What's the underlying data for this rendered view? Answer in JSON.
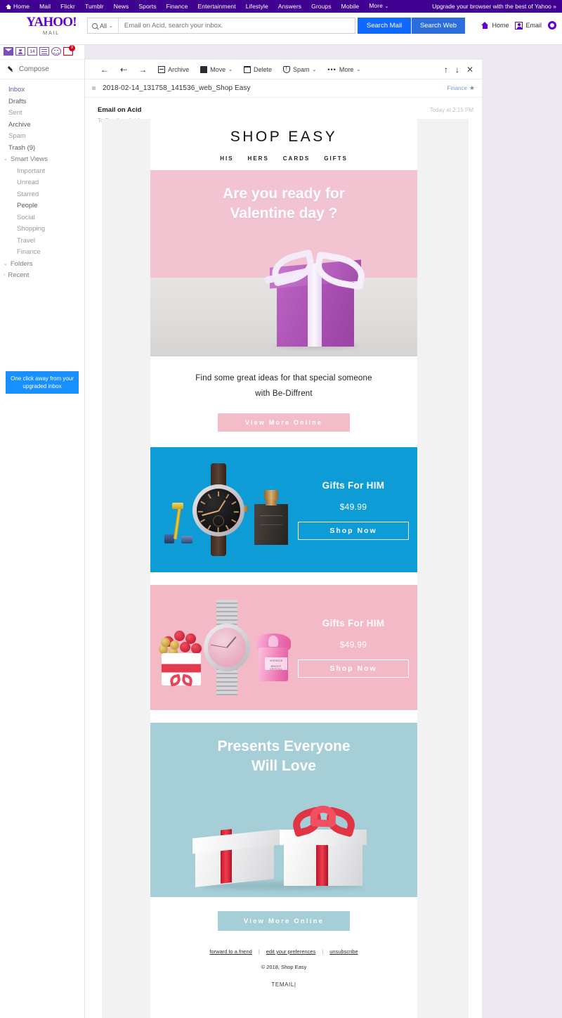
{
  "topnav": {
    "items": [
      "Home",
      "Mail",
      "Flickr",
      "Tumblr",
      "News",
      "Sports",
      "Finance",
      "Entertainment",
      "Lifestyle",
      "Answers",
      "Groups",
      "Mobile",
      "More"
    ],
    "more_caret": "⌄",
    "upgrade_text": "Upgrade your browser with the best of Yahoo »",
    "bg_color": "#400090"
  },
  "header": {
    "logo_main": "YAHOO!",
    "logo_sub": "MAIL",
    "search_scope": "All",
    "search_scope_caret": "⌄",
    "search_placeholder": "Email on Acid, search your inbox.",
    "search_value": "",
    "btn_search_mail": "Search Mail",
    "btn_search_web": "Search Web",
    "right_home": "Home",
    "right_email": "Email",
    "accent_blue": "#0f69ff"
  },
  "sidebar": {
    "app_icons": [
      "mail-icon",
      "contacts-icon",
      "calendar-icon",
      "notepad-icon",
      "smiley-icon",
      "news-icon"
    ],
    "calendar_day": "14",
    "news_badge": "9",
    "compose_label": "Compose",
    "items": [
      {
        "label": "Inbox",
        "level": 0,
        "state": "active"
      },
      {
        "label": "Drafts",
        "level": 0,
        "state": "strong"
      },
      {
        "label": "Sent",
        "level": 0,
        "state": "normal"
      },
      {
        "label": "Archive",
        "level": 0,
        "state": "strong"
      },
      {
        "label": "Spam",
        "level": 0,
        "state": "normal"
      },
      {
        "label": "Trash (9)",
        "level": 0,
        "state": "strong"
      },
      {
        "label": "Smart Views",
        "level": 0,
        "state": "group",
        "chevron": "⌄"
      },
      {
        "label": "Important",
        "level": 1,
        "state": "normal"
      },
      {
        "label": "Unread",
        "level": 1,
        "state": "normal"
      },
      {
        "label": "Starred",
        "level": 1,
        "state": "normal"
      },
      {
        "label": "People",
        "level": 1,
        "state": "strong"
      },
      {
        "label": "Social",
        "level": 1,
        "state": "normal"
      },
      {
        "label": "Shopping",
        "level": 1,
        "state": "normal"
      },
      {
        "label": "Travel",
        "level": 1,
        "state": "normal"
      },
      {
        "label": "Finance",
        "level": 1,
        "state": "normal"
      },
      {
        "label": "Folders",
        "level": 0,
        "state": "group",
        "chevron": "⌄"
      },
      {
        "label": "Recent",
        "level": 0,
        "state": "group",
        "chevron": "›"
      }
    ],
    "promo_text": "One click away from your upgraded inbox",
    "promo_color": "#188fff"
  },
  "toolbar": {
    "back_arrow": "←",
    "prev_arrow": "⇠",
    "next_arrow": "→",
    "archive_label": "Archive",
    "move_label": "Move",
    "move_caret": "⌄",
    "delete_label": "Delete",
    "spam_label": "Spam",
    "spam_caret": "⌄",
    "more_label": "More",
    "more_caret": "⌄",
    "more_dots": "•••",
    "up_arrow": "↑",
    "down_arrow": "↓",
    "close": "✕"
  },
  "message": {
    "subject": "2018-02-14_131758_141536_web_Shop Easy",
    "tag": "Finance",
    "star": "★",
    "sender": "Email on Acid",
    "recipient": "To  Email on Acid",
    "date": "Today at 2:15 PM"
  },
  "email": {
    "brand_title": "SHOP EASY",
    "nav": [
      "HIS",
      "HERS",
      "CARDS",
      "GIFTS"
    ],
    "hero_line1": "Are you ready for",
    "hero_line2": "Valentine day ?",
    "intro_line1": "Find some great ideas for that special someone",
    "intro_line2": "with Be-Diffrent",
    "cta_view_more_top": "View More Online",
    "bands": [
      {
        "heading": "Gifts For HIM",
        "price": "$49.99",
        "cta": "Shop Now",
        "bg": "#0e9cd6"
      },
      {
        "heading": "Gifts For HIM",
        "price": "$49.99",
        "cta": "Shop Now",
        "bg": "#f4b9c6"
      }
    ],
    "teal_line1": "Presents Everyone",
    "teal_line2": "Will Love",
    "cta_view_more_bottom": "View More Online",
    "footer_links": [
      "forward to a friend",
      "edit your preferences",
      "unsubscribe"
    ],
    "footer_sep": "|",
    "copyright": "© 2018, Shop Easy",
    "footer_brand": "TEMAIL|",
    "perfume_label_1": "VERSACE",
    "perfume_label_2": "BRIGHT CRYSTAL",
    "colors": {
      "hero_pink": "#f2c3d1",
      "band_blue": "#0e9cd6",
      "band_pink": "#f4b9c6",
      "teal": "#a5ced6",
      "cta_pink": "#f2bcc9"
    }
  }
}
